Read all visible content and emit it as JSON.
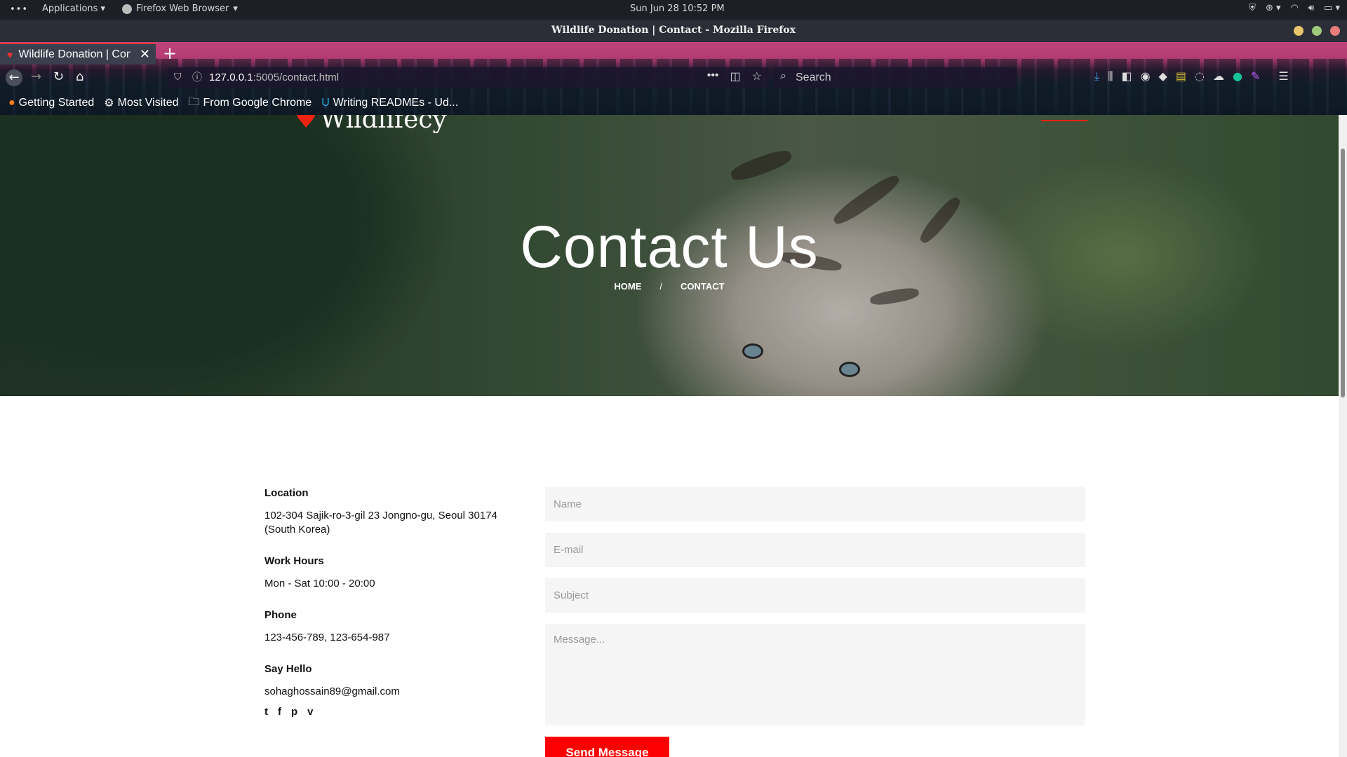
{
  "system_bar": {
    "dots": "•••",
    "applications": "Applications",
    "active_app": "Firefox Web Browser",
    "clock": "Sun Jun 28  10:52 PM"
  },
  "window": {
    "title": "Wildlife Donation | Contact - Mozilla Firefox"
  },
  "tab": {
    "label": "Wildlife Donation | Con"
  },
  "urlbar": {
    "host": "127.0.0.1",
    "path": ":5005/contact.html"
  },
  "search": {
    "placeholder": "Search"
  },
  "bookmarks": [
    {
      "label": "Getting Started",
      "icon": "firefox-icon"
    },
    {
      "label": "Most Visited",
      "icon": "gear-icon"
    },
    {
      "label": "From Google Chrome",
      "icon": "folder-icon"
    },
    {
      "label": "Writing READMEs - Ud...",
      "icon": "udacity-icon"
    }
  ],
  "site": {
    "logo": "Wildlifecy",
    "hero_title": "Contact Us",
    "breadcrumb": {
      "home": "HOME",
      "separator": "/",
      "current": "CONTACT"
    }
  },
  "contact_info": {
    "location_label": "Location",
    "location_line1": "102-304 Sajik-ro-3-gil 23 Jongno-gu, Seoul 30174",
    "location_line2": "(South Korea)",
    "hours_label": "Work Hours",
    "hours_value": "Mon - Sat 10:00 - 20:00",
    "phone_label": "Phone",
    "phone_value": "123-456-789, 123-654-987",
    "hello_label": "Say Hello",
    "hello_value": "sohaghossain89@gmail.com",
    "socials": [
      "t",
      "f",
      "p",
      "v"
    ]
  },
  "form": {
    "name_placeholder": "Name",
    "email_placeholder": "E-mail",
    "subject_placeholder": "Subject",
    "message_placeholder": "Message...",
    "send_label": "Send Message"
  },
  "colors": {
    "accent": "#ff0000",
    "field_bg": "#f5f5f5",
    "tab_highlight": "#e83a3a"
  }
}
